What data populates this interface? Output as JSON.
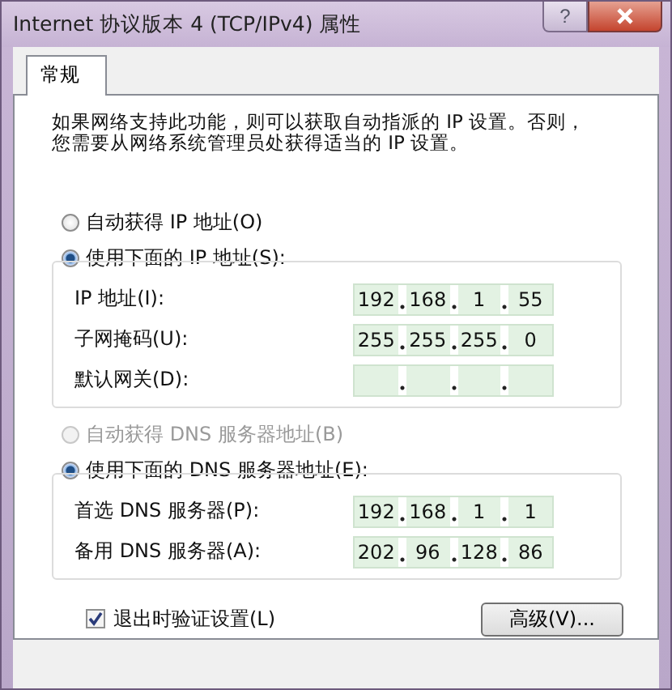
{
  "window": {
    "title": "Internet 协议版本 4 (TCP/IPv4) 属性",
    "help": "?"
  },
  "tabs": [
    {
      "label": "常规",
      "selected": true
    }
  ],
  "description": "如果网络支持此功能，则可以获取自动指派的 IP 设置。否则，您需要从网络系统管理员处获得适当的 IP 设置。",
  "ip_mode": [
    {
      "label": "自动获得 IP 地址(O)",
      "selected": false,
      "disabled": false
    },
    {
      "label": "使用下面的 IP 地址(S):",
      "selected": true,
      "disabled": false
    }
  ],
  "ip_fields": [
    {
      "label": "IP 地址(I):",
      "octets": [
        "192",
        "168",
        "1",
        "55"
      ]
    },
    {
      "label": "子网掩码(U):",
      "octets": [
        "255",
        "255",
        "255",
        "0"
      ]
    },
    {
      "label": "默认网关(D):"
    }
  ],
  "dns_mode": [
    {
      "label": "自动获得 DNS 服务器地址(B)",
      "selected": false,
      "disabled": true
    },
    {
      "label": "使用下面的 DNS 服务器地址(E):",
      "selected": true,
      "disabled": false
    }
  ],
  "dns_fields": [
    {
      "label": "首选 DNS 服务器(P):",
      "octets": [
        "192",
        "168",
        "1",
        "1"
      ]
    },
    {
      "label": "备用 DNS 服务器(A):",
      "octets": [
        "202",
        "96",
        "128",
        "86"
      ]
    }
  ],
  "validate": {
    "label": "退出时验证设置(L)",
    "checked": true
  },
  "advanced_button": "高级(V)..."
}
